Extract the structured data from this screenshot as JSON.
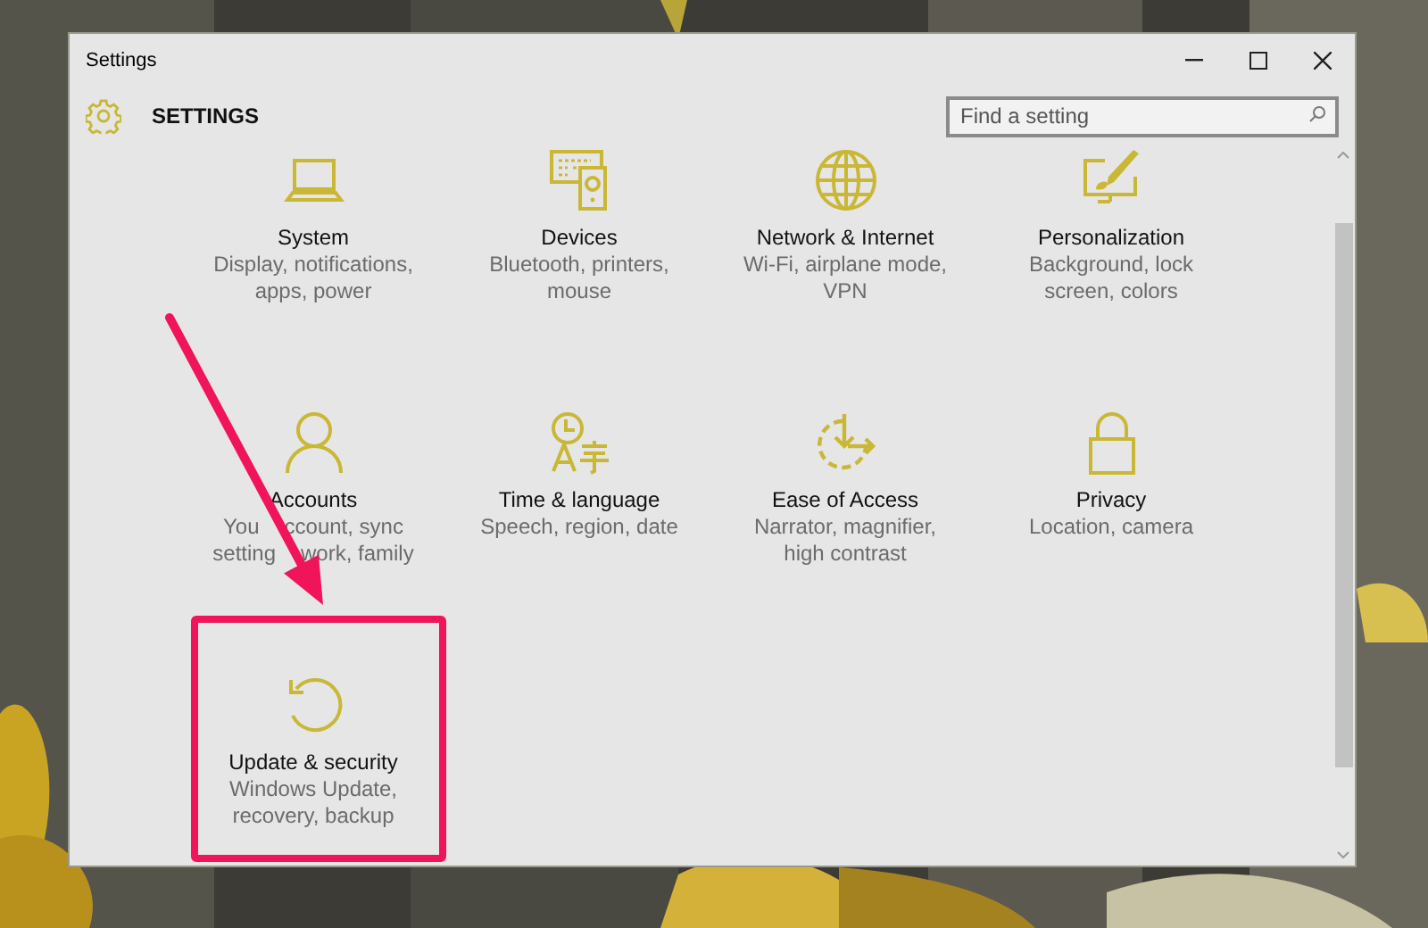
{
  "window": {
    "title": "Settings"
  },
  "header": {
    "title": "SETTINGS"
  },
  "search": {
    "placeholder": "Find a setting"
  },
  "categories": [
    {
      "title": "System",
      "description": "Display, notifications, apps, power",
      "highlighted": false
    },
    {
      "title": "Devices",
      "description": "Bluetooth, printers, mouse",
      "highlighted": false
    },
    {
      "title": "Network & Internet",
      "description": "Wi-Fi, airplane mode, VPN",
      "highlighted": false
    },
    {
      "title": "Personalization",
      "description": "Background, lock screen, colors",
      "highlighted": false
    },
    {
      "title": "Accounts",
      "description_lines": [
        [
          "You",
          "ccount, sync"
        ],
        [
          "setting",
          "work, family"
        ]
      ],
      "highlighted": false
    },
    {
      "title": "Time & language",
      "description": "Speech, region, date",
      "highlighted": false
    },
    {
      "title": "Ease of Access",
      "description": "Narrator, magnifier, high contrast",
      "highlighted": false
    },
    {
      "title": "Privacy",
      "description": "Location, camera",
      "highlighted": false
    },
    {
      "title": "Update & security",
      "description": "Windows Update, recovery, backup",
      "highlighted": true
    }
  ]
}
